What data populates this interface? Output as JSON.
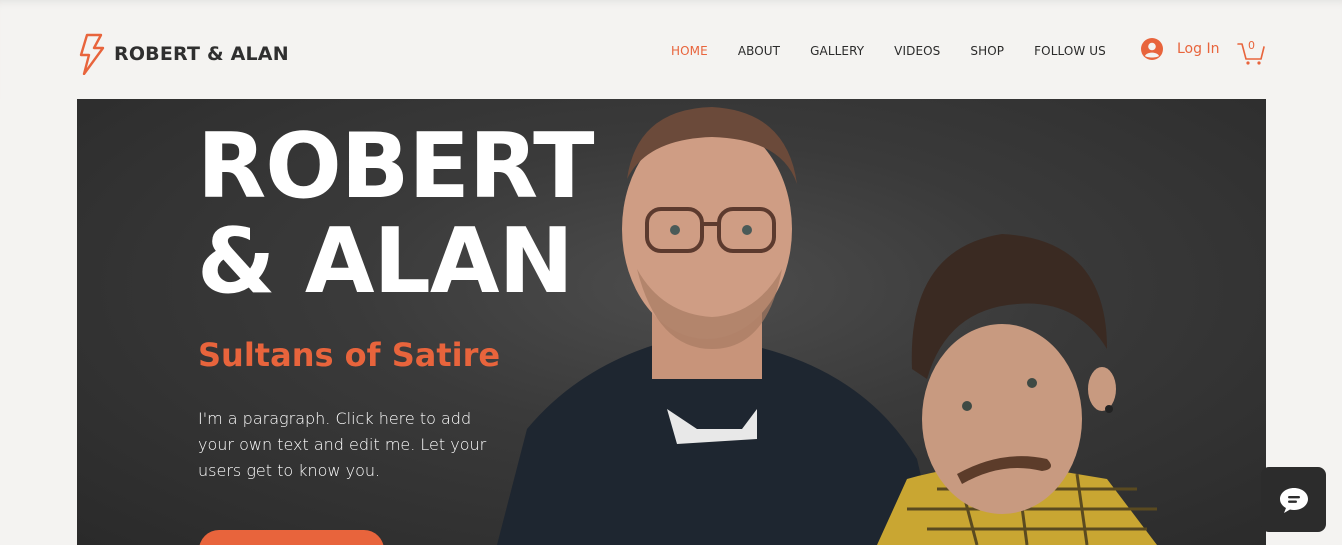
{
  "brand": {
    "name": "ROBERT & ALAN",
    "logo_icon": "lightning-bolt-icon",
    "accent_color": "#e8643c"
  },
  "nav": {
    "items": [
      {
        "label": "HOME",
        "active": true
      },
      {
        "label": "ABOUT",
        "active": false
      },
      {
        "label": "GALLERY",
        "active": false
      },
      {
        "label": "VIDEOS",
        "active": false
      },
      {
        "label": "SHOP",
        "active": false
      },
      {
        "label": "FOLLOW US",
        "active": false
      }
    ]
  },
  "account": {
    "login_label": "Log In",
    "avatar_icon": "user-avatar-icon"
  },
  "cart": {
    "count": "0",
    "icon": "shopping-cart-icon"
  },
  "hero": {
    "title_line1": "ROBERT",
    "title_line2": "& ALAN",
    "subtitle": "Sultans of Satire",
    "paragraph": "I'm a paragraph. Click here to add your own text and edit me. Let your users get to know you.",
    "background_color": "#333333"
  },
  "chat": {
    "icon": "chat-bubble-icon"
  }
}
